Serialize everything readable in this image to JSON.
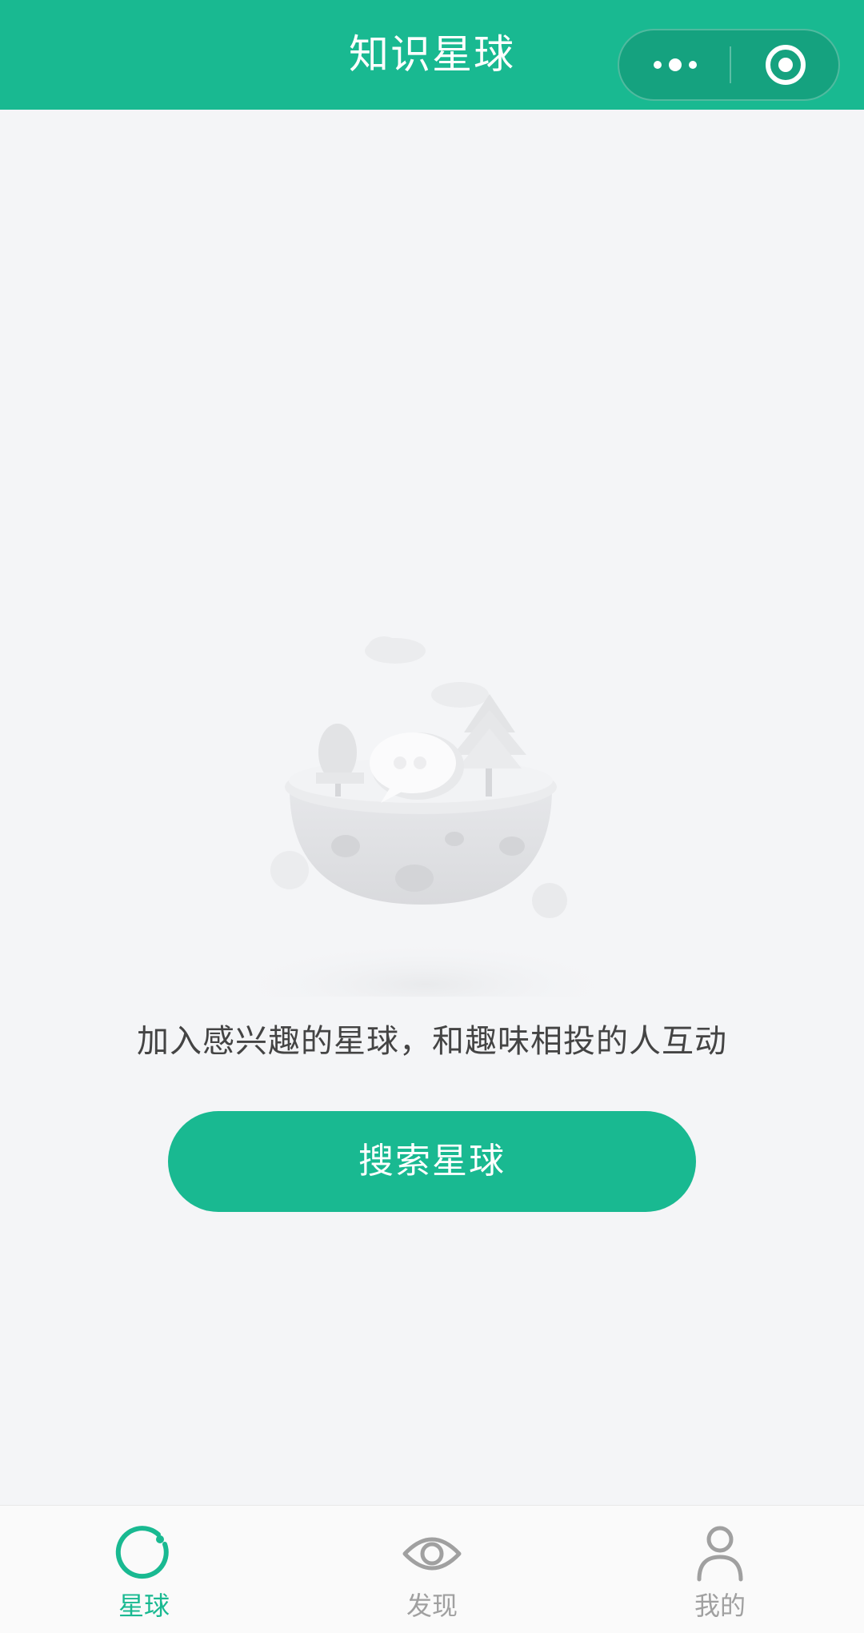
{
  "colors": {
    "brand": "#19b991",
    "background": "#f4f5f7",
    "tab_inactive": "#a0a0a0",
    "text": "#444444"
  },
  "header": {
    "title": "知识星球",
    "capsule": {
      "more_icon": "more-dots-icon",
      "close_icon": "target-close-icon"
    }
  },
  "empty_state": {
    "illustration": "floating-planet-island-illustration",
    "message": "加入感兴趣的星球，和趣味相投的人互动",
    "button_label": "搜索星球"
  },
  "tabbar": {
    "tabs": [
      {
        "label": "星球",
        "icon": "planet-ring-icon",
        "active": true
      },
      {
        "label": "发现",
        "icon": "eye-icon",
        "active": false
      },
      {
        "label": "我的",
        "icon": "user-icon",
        "active": false
      }
    ]
  }
}
